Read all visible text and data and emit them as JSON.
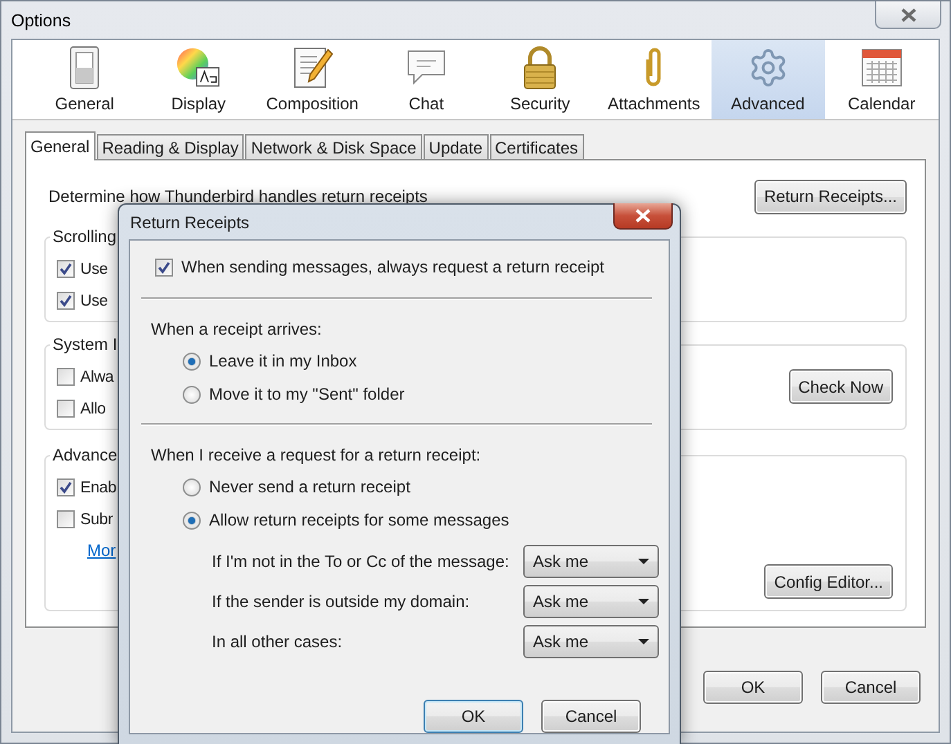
{
  "window": {
    "title": "Options"
  },
  "categories": [
    {
      "label": "General",
      "selected": false
    },
    {
      "label": "Display",
      "selected": false
    },
    {
      "label": "Composition",
      "selected": false
    },
    {
      "label": "Chat",
      "selected": false
    },
    {
      "label": "Security",
      "selected": false
    },
    {
      "label": "Attachments",
      "selected": false
    },
    {
      "label": "Advanced",
      "selected": true
    },
    {
      "label": "Calendar",
      "selected": false
    }
  ],
  "subtabs": [
    {
      "label": "General",
      "selected": true
    },
    {
      "label": "Reading & Display",
      "selected": false
    },
    {
      "label": "Network & Disk Space",
      "selected": false
    },
    {
      "label": "Update",
      "selected": false
    },
    {
      "label": "Certificates",
      "selected": false
    }
  ],
  "receipts": {
    "text": "Determine how Thunderbird handles return receipts",
    "button": "Return Receipts..."
  },
  "groups": [
    {
      "legend": "Scrolling",
      "items": [
        {
          "label": "Use",
          "checked": true
        },
        {
          "label": "Use",
          "checked": true
        }
      ]
    },
    {
      "legend": "System I",
      "items": [
        {
          "label": "Alwa",
          "checked": false
        },
        {
          "label": "Allo",
          "checked": false
        }
      ],
      "button": "Check Now"
    },
    {
      "legend": "Advance",
      "items": [
        {
          "label": "Enab",
          "checked": true
        },
        {
          "label": "Subr",
          "checked": false
        }
      ],
      "link": "Mor",
      "button": "Config Editor..."
    }
  ],
  "buttons": [
    "OK",
    "Cancel"
  ],
  "dialog": {
    "title": "Return Receipts",
    "request": {
      "label": "When sending messages, always request a return receipt",
      "checked": true
    },
    "arrive_heading": "When a receipt arrives:",
    "arrive_options": [
      {
        "label": "Leave it in my Inbox",
        "selected": true
      },
      {
        "label": "Move it to my \"Sent\" folder",
        "selected": false
      }
    ],
    "request_heading": "When I receive a request for a return receipt:",
    "request_options": [
      {
        "label": "Never send a return receipt",
        "selected": false
      },
      {
        "label": "Allow return receipts for some messages",
        "selected": true
      }
    ],
    "rules": [
      {
        "label": "If I'm not in the To or Cc of the message:",
        "value": "Ask me"
      },
      {
        "label": "If the sender is outside my domain:",
        "value": "Ask me"
      },
      {
        "label": "In all other cases:",
        "value": "Ask me"
      }
    ],
    "buttons": [
      "OK",
      "Cancel"
    ]
  }
}
